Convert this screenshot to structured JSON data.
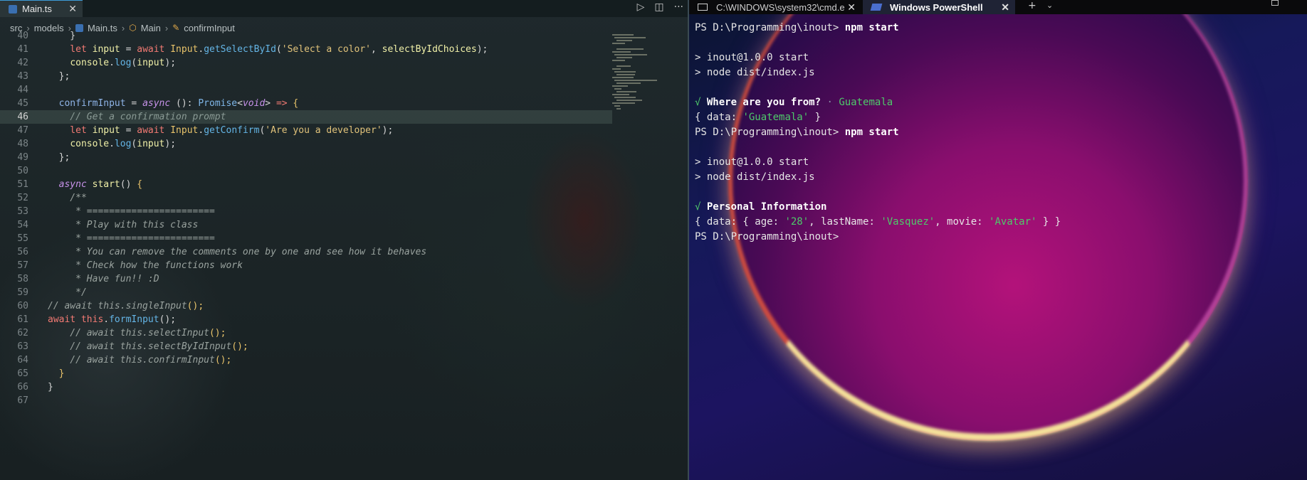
{
  "editor": {
    "tab": {
      "label": "Main.ts",
      "close": "✕"
    },
    "actions": {
      "run": "▷",
      "split": "◫",
      "more": "···"
    },
    "breadcrumb": {
      "src": "src",
      "models": "models",
      "file": "Main.ts",
      "class": "Main",
      "member": "confirmInput"
    },
    "lines": [
      {
        "n": "40",
        "segments": [
          [
            "pu",
            "    }"
          ]
        ]
      },
      {
        "n": "41",
        "segments": [
          [
            "k",
            "    let "
          ],
          [
            "vr",
            "input"
          ],
          [
            "pu",
            " = "
          ],
          [
            "k",
            "await "
          ],
          [
            "cls",
            "Input"
          ],
          [
            "pu",
            "."
          ],
          [
            "fn",
            "getSelectById"
          ],
          [
            "pu",
            "("
          ],
          [
            "st",
            "'Select a color'"
          ],
          [
            "pu",
            ", "
          ],
          [
            "vr",
            "selectByIdChoices"
          ],
          [
            "pu",
            ");"
          ]
        ]
      },
      {
        "n": "42",
        "segments": [
          [
            "pu",
            "    "
          ],
          [
            "vr",
            "console"
          ],
          [
            "pu",
            "."
          ],
          [
            "fn",
            "log"
          ],
          [
            "pu",
            "("
          ],
          [
            "vr",
            "input"
          ],
          [
            "pu",
            ");"
          ]
        ]
      },
      {
        "n": "43",
        "segments": [
          [
            "pu",
            "  };"
          ]
        ]
      },
      {
        "n": "44",
        "segments": []
      },
      {
        "n": "45",
        "segments": [
          [
            "kw",
            "  confirmInput"
          ],
          [
            "pu",
            " = "
          ],
          [
            "ki",
            "async"
          ],
          [
            "pu",
            " (): "
          ],
          [
            "ty",
            "Promise"
          ],
          [
            "pu",
            "<"
          ],
          [
            "ki",
            "void"
          ],
          [
            "pu",
            "> "
          ],
          [
            "k",
            "=> "
          ],
          [
            "br",
            "{"
          ]
        ]
      },
      {
        "n": "46",
        "hl": true,
        "segments": [
          [
            "cmhl",
            "    // Get a confirmation prompt"
          ]
        ]
      },
      {
        "n": "47",
        "segments": [
          [
            "k",
            "    let "
          ],
          [
            "vr",
            "input"
          ],
          [
            "pu",
            " = "
          ],
          [
            "k",
            "await "
          ],
          [
            "cls",
            "Input"
          ],
          [
            "pu",
            "."
          ],
          [
            "fn",
            "getConfirm"
          ],
          [
            "pu",
            "("
          ],
          [
            "st",
            "'Are you a developer'"
          ],
          [
            "pu",
            ");"
          ]
        ]
      },
      {
        "n": "48",
        "segments": [
          [
            "pu",
            "    "
          ],
          [
            "vr",
            "console"
          ],
          [
            "pu",
            "."
          ],
          [
            "fn",
            "log"
          ],
          [
            "pu",
            "("
          ],
          [
            "vr",
            "input"
          ],
          [
            "pu",
            ");"
          ]
        ]
      },
      {
        "n": "49",
        "segments": [
          [
            "pu",
            "  };"
          ]
        ]
      },
      {
        "n": "50",
        "segments": []
      },
      {
        "n": "51",
        "segments": [
          [
            "ki",
            "  async "
          ],
          [
            "vr",
            "start"
          ],
          [
            "pu",
            "() "
          ],
          [
            "br",
            "{"
          ]
        ]
      },
      {
        "n": "52",
        "segments": [
          [
            "cm",
            "    /**"
          ]
        ]
      },
      {
        "n": "53",
        "segments": [
          [
            "cm",
            "     * ======================="
          ]
        ]
      },
      {
        "n": "54",
        "segments": [
          [
            "cm",
            "     * Play with this class"
          ]
        ]
      },
      {
        "n": "55",
        "segments": [
          [
            "cm",
            "     * ======================="
          ]
        ]
      },
      {
        "n": "56",
        "segments": [
          [
            "cm",
            "     * You can remove the comments one by one and see how it behaves"
          ]
        ]
      },
      {
        "n": "57",
        "segments": [
          [
            "cm",
            "     * Check how the functions work"
          ]
        ]
      },
      {
        "n": "58",
        "segments": [
          [
            "cm",
            "     * Have fun!! :D"
          ]
        ]
      },
      {
        "n": "59",
        "segments": [
          [
            "cm",
            "     */"
          ]
        ]
      },
      {
        "n": "60",
        "segments": [
          [
            "cm",
            "// await this.singleInput"
          ],
          [
            "br",
            "();"
          ]
        ]
      },
      {
        "n": "61",
        "segments": [
          [
            "k",
            "await "
          ],
          [
            "k",
            "this"
          ],
          [
            "pu",
            "."
          ],
          [
            "fn",
            "formInput"
          ],
          [
            "pu",
            "();"
          ]
        ]
      },
      {
        "n": "62",
        "segments": [
          [
            "cm",
            "    // await this.selectInput"
          ],
          [
            "br",
            "();"
          ]
        ]
      },
      {
        "n": "63",
        "segments": [
          [
            "cm",
            "    // await this.selectByIdInput"
          ],
          [
            "br",
            "();"
          ]
        ]
      },
      {
        "n": "64",
        "segments": [
          [
            "cm",
            "    // await this.confirmInput"
          ],
          [
            "br",
            "();"
          ]
        ]
      },
      {
        "n": "65",
        "segments": [
          [
            "br",
            "  }"
          ]
        ]
      },
      {
        "n": "66",
        "segments": [
          [
            "pu",
            "}"
          ]
        ]
      },
      {
        "n": "67",
        "segments": []
      }
    ]
  },
  "terminal": {
    "tabs": {
      "cmd": "C:\\WINDOWS\\system32\\cmd.e",
      "powershell": "Windows PowerShell",
      "close": "✕",
      "new": "+",
      "dropdown": "⌄"
    },
    "lines": [
      [
        [
          "",
          "PS D:\\Programming\\inout> "
        ],
        [
          "cmdw",
          "npm start"
        ]
      ],
      [],
      [
        [
          "",
          "> inout@1.0.0 start"
        ]
      ],
      [
        [
          "",
          "> node dist/index.js"
        ]
      ],
      [],
      [
        [
          "chk",
          "√ "
        ],
        [
          "b",
          "Where are you from?"
        ],
        [
          "gr",
          " · "
        ],
        [
          "g",
          "Guatemala"
        ]
      ],
      [
        [
          "",
          "{ data: "
        ],
        [
          "g",
          "'Guatemala'"
        ],
        [
          "",
          " }"
        ]
      ],
      [
        [
          "",
          "PS D:\\Programming\\inout> "
        ],
        [
          "cmdw",
          "npm start"
        ]
      ],
      [],
      [
        [
          "",
          "> inout@1.0.0 start"
        ]
      ],
      [
        [
          "",
          "> node dist/index.js"
        ]
      ],
      [],
      [
        [
          "chk",
          "√ "
        ],
        [
          "b",
          "Personal Information"
        ]
      ],
      [
        [
          "",
          "{ data: { age: "
        ],
        [
          "g",
          "'28'"
        ],
        [
          "",
          ", lastName: "
        ],
        [
          "g",
          "'Vasquez'"
        ],
        [
          "",
          ", movie: "
        ],
        [
          "g",
          "'Avatar'"
        ],
        [
          "",
          " } }"
        ]
      ],
      [
        [
          "",
          "PS D:\\Programming\\inout>"
        ]
      ]
    ]
  }
}
